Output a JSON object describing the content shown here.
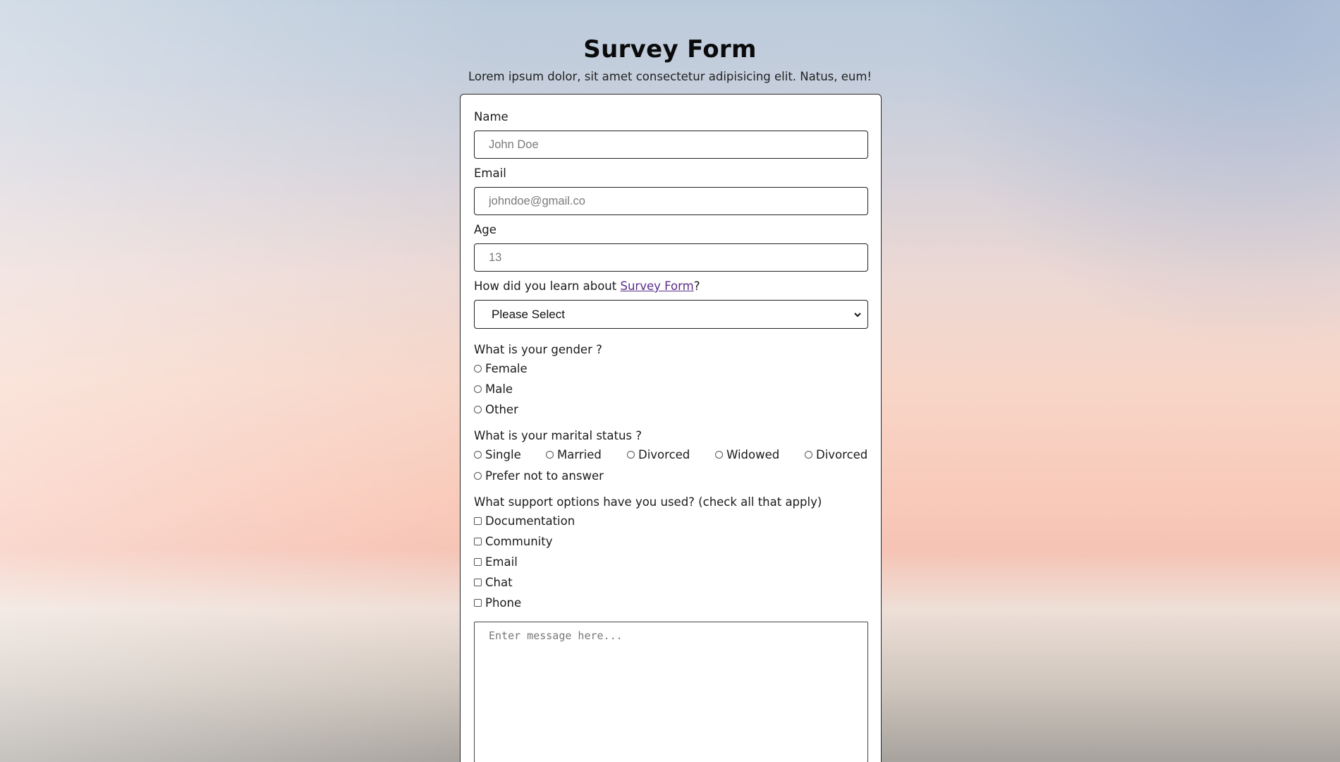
{
  "header": {
    "title": "Survey Form",
    "subtitle": "Lorem ipsum dolor, sit amet consectetur adipisicing elit. Natus, eum!"
  },
  "form": {
    "name": {
      "label": "Name",
      "placeholder": "John Doe"
    },
    "email": {
      "label": "Email",
      "placeholder": "johndoe@gmail.co"
    },
    "age": {
      "label": "Age",
      "placeholder": "13"
    },
    "referral": {
      "label_prefix": "How did you learn about ",
      "link_text": "Survey Form",
      "label_suffix": "?",
      "selected": "Please Select"
    },
    "gender": {
      "label": "What is your gender ?",
      "options": [
        "Female",
        "Male",
        "Other"
      ]
    },
    "marital": {
      "label": "What is your marital status ?",
      "options": [
        "Single",
        "Married",
        "Divorced",
        "Widowed",
        "Divorced",
        "Prefer not to answer"
      ]
    },
    "support": {
      "label": "What support options have you used? (check all that apply)",
      "options": [
        "Documentation",
        "Community",
        "Email",
        "Chat",
        "Phone"
      ]
    },
    "message": {
      "placeholder": "Enter message here..."
    }
  }
}
